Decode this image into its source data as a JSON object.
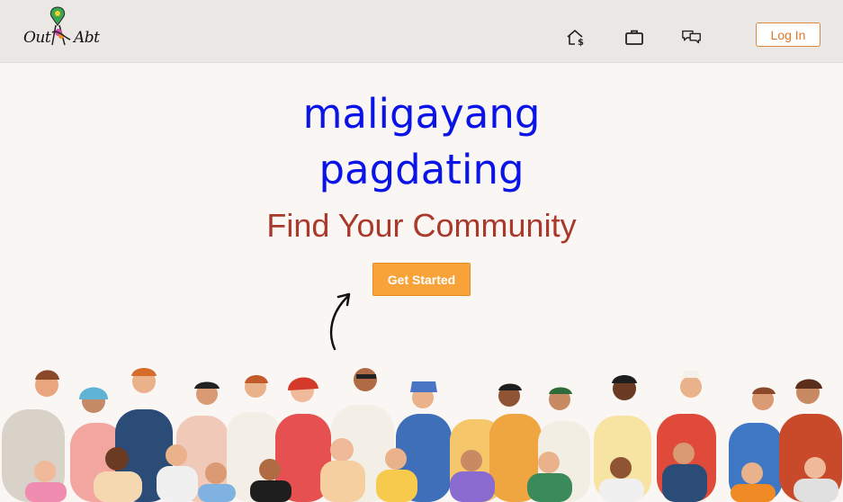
{
  "header": {
    "logo": {
      "left_text": "Out",
      "right_text": "Abt"
    },
    "nav": [
      {
        "name": "home-dollar-icon"
      },
      {
        "name": "briefcase-icon"
      },
      {
        "name": "chat-bubbles-icon"
      }
    ],
    "login_label": "Log In"
  },
  "hero": {
    "welcome_line1": "maligayang",
    "welcome_line2": "pagdating",
    "tagline": "Find Your Community",
    "cta_label": "Get Started"
  },
  "colors": {
    "header_bg": "#ebe7e4",
    "page_bg": "#faf6f4",
    "welcome": "#0a14e6",
    "tagline": "#a8392b",
    "cta": "#f7a33a",
    "login_accent": "#e0782a"
  },
  "illustration": {
    "name": "diverse-crowd-illustration"
  }
}
